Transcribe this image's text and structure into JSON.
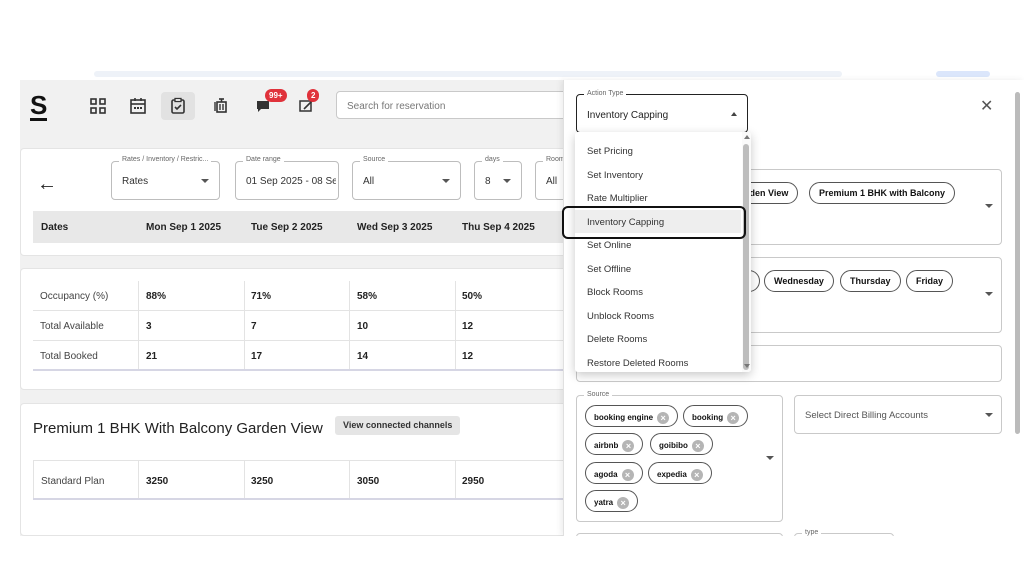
{
  "logo": "S",
  "nav": {
    "messages_badge": "99+",
    "reviews_badge": "2",
    "search_placeholder": "Search for reservation"
  },
  "filters": {
    "rates_label": "Rates / Inventory / Restric...",
    "rates_value": "Rates",
    "date_label": "Date range",
    "date_value": "01 Sep 2025 - 08 Se",
    "source_label": "Source",
    "source_value": "All",
    "days_label": "days",
    "days_value": "8",
    "room_label": "Room",
    "room_value": "All"
  },
  "dates_header": {
    "label": "Dates",
    "days": [
      "Mon Sep 1 2025",
      "Tue Sep 2 2025",
      "Wed Sep 3 2025",
      "Thu Sep 4 2025"
    ]
  },
  "stats": {
    "occupancy": {
      "label": "Occupancy (%)",
      "values": [
        "88%",
        "71%",
        "58%",
        "50%"
      ]
    },
    "available": {
      "label": "Total Available",
      "values": [
        "3",
        "7",
        "10",
        "12"
      ]
    },
    "booked": {
      "label": "Total Booked",
      "values": [
        "21",
        "17",
        "14",
        "12"
      ]
    }
  },
  "room": {
    "title": "Premium 1 BHK With Balcony Garden View",
    "channels_button": "View connected channels",
    "plan": {
      "label": "Standard Plan",
      "values": [
        "3250",
        "3250",
        "3050",
        "2950"
      ]
    }
  },
  "panel": {
    "action_type_label": "Action Type",
    "action_type_value": "Inventory Capping",
    "room_chips": [
      "rden View",
      "Premium 1 BHK with Balcony"
    ],
    "day_chips": [
      "Wednesday",
      "Thursday",
      "Friday"
    ],
    "source_label": "Source",
    "source_tags": [
      "booking engine",
      "booking",
      "airbnb",
      "goibibo",
      "agoda",
      "expedia",
      "yatra"
    ],
    "billing_placeholder": "Select Direct Billing Accounts",
    "type_label": "type"
  },
  "dropdown": {
    "items": [
      "Set Pricing",
      "Set Inventory",
      "Rate Multiplier",
      "Inventory Capping",
      "Set Online",
      "Set Offline",
      "Block Rooms",
      "Unblock Rooms",
      "Delete Rooms",
      "Restore Deleted Rooms"
    ],
    "selected": "Inventory Capping"
  }
}
